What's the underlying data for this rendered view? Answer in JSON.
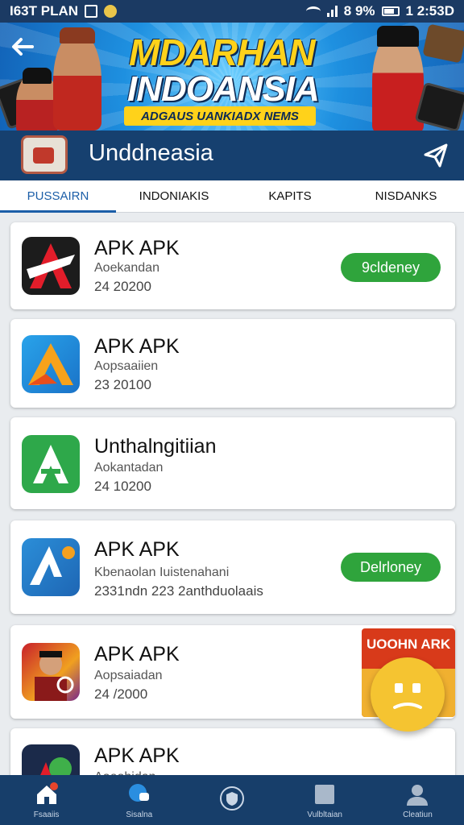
{
  "status_bar": {
    "left_text": "I63T PLAN",
    "battery_percent": "8 9%",
    "time": "1 2:53D"
  },
  "banner": {
    "title_line1": "MDARHAN",
    "title_line2": "INDOANSIA",
    "subtitle": "ADGAUS UANKIADX NEMS"
  },
  "appbar": {
    "title": "Unddneasia"
  },
  "tabs": [
    {
      "label": "PUSSAIRN",
      "active": true
    },
    {
      "label": "INDONIAKIS",
      "active": false
    },
    {
      "label": "KAPITS",
      "active": false
    },
    {
      "label": "NISDANKS",
      "active": false
    }
  ],
  "apps": [
    {
      "name": "APK APK",
      "subtitle": "Aoekandan",
      "meta": "24 20200",
      "button": "9cldeney"
    },
    {
      "name": "APK APK",
      "subtitle": "Aopsaaiien",
      "meta": "23 20100",
      "button": null
    },
    {
      "name": "Unthalngitiian",
      "subtitle": "Aokantadan",
      "meta": "24 10200",
      "button": null
    },
    {
      "name": "APK APK",
      "subtitle": "Kbenaolan Iuistenahani",
      "meta": "2331ndn 223 2anthduolaais",
      "button": "Delrloney"
    },
    {
      "name": "APK APK",
      "subtitle": "Aopsaiadan",
      "meta": "24 /2000",
      "button": null,
      "promo": "UOOHN ARK"
    },
    {
      "name": "APK APK",
      "subtitle": "Aoeohidan",
      "meta": "",
      "button": null
    }
  ],
  "bottom_nav": [
    {
      "label": "Fsaaiis",
      "icon": "home-icon"
    },
    {
      "label": "Sisalna",
      "icon": "chat-icon"
    },
    {
      "label": "",
      "icon": "shield-icon"
    },
    {
      "label": "Vulbltaian",
      "icon": "apps-icon"
    },
    {
      "label": "Cleatiun",
      "icon": "profile-icon"
    }
  ],
  "colors": {
    "primary": "#16406f",
    "accent": "#1b5ea8",
    "download_green": "#2fa43c",
    "banner_yellow": "#ffd21a"
  }
}
